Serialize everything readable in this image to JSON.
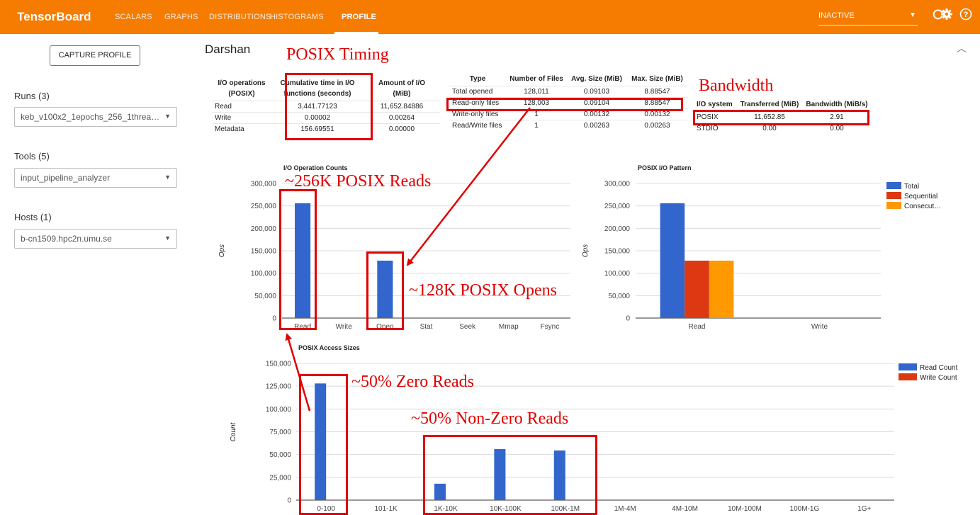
{
  "app": {
    "brand": "TensorBoard",
    "tabs": [
      "SCALARS",
      "GRAPHS",
      "DISTRIBUTIONS",
      "HISTOGRAMS",
      "PROFILE"
    ],
    "active_tab": "PROFILE",
    "run_selector": "INACTIVE",
    "icons": [
      "refresh-icon",
      "settings-icon",
      "help-icon"
    ],
    "accent_color": "#f57c00"
  },
  "sidebar": {
    "capture_button": "CAPTURE PROFILE",
    "runs_label": "Runs (3)",
    "runs_value": "keb_v100x2_1epochs_256_1threa…",
    "tools_label": "Tools (5)",
    "tools_value": "input_pipeline_analyzer",
    "hosts_label": "Hosts (1)",
    "hosts_value": "b-cn1509.hpc2n.umu.se"
  },
  "main": {
    "title": "Darshan",
    "io_table": {
      "headers": [
        [
          "I/O operations",
          "(POSIX)"
        ],
        [
          "Cumulative time in I/O",
          "functions (seconds)"
        ],
        [
          "Amount of I/O",
          "(MiB)"
        ]
      ],
      "rows": [
        [
          "Read",
          "3,441.77123",
          "11,652.84886"
        ],
        [
          "Write",
          "0.00002",
          "0.00264"
        ],
        [
          "Metadata",
          "156.69551",
          "0.00000"
        ]
      ]
    },
    "files_table": {
      "headers": [
        "Type",
        "Number of Files",
        "Avg. Size (MiB)",
        "Max. Size (MiB)"
      ],
      "rows": [
        [
          "Total opened",
          "128,011",
          "0.09103",
          "8.88547"
        ],
        [
          "Read-only files",
          "128,003",
          "0.09104",
          "8.88547"
        ],
        [
          "Write-only files",
          "1",
          "0.00132",
          "0.00132"
        ],
        [
          "Read/Write files",
          "1",
          "0.00263",
          "0.00263"
        ]
      ]
    },
    "bw_table": {
      "headers": [
        "I/O system",
        "Transferred (MiB)",
        "Bandwidth (MiB/s)"
      ],
      "rows": [
        [
          "POSIX",
          "11,652.85",
          "2.91"
        ],
        [
          "STDIO",
          "0.00",
          "0.00"
        ]
      ]
    },
    "annotations": {
      "posix_timing": "POSIX Timing",
      "bandwidth": "Bandwidth",
      "posix_reads": "~256K POSIX Reads",
      "posix_opens": "~128K POSIX Opens",
      "zero_reads": "~50% Zero Reads",
      "nonzero_reads": "~50% Non-Zero Reads"
    }
  },
  "chart_data": [
    {
      "type": "bar",
      "title": "I/O Operation Counts",
      "ylabel": "Ops",
      "categories": [
        "Read",
        "Write",
        "Open",
        "Stat",
        "Seek",
        "Mmap",
        "Fsync"
      ],
      "values": [
        256000,
        0,
        128000,
        0,
        0,
        0,
        0
      ],
      "ylim": [
        0,
        300000
      ],
      "yticks": [
        "0",
        "50,000",
        "100,000",
        "150,000",
        "200,000",
        "250,000",
        "300,000"
      ],
      "colors": [
        "#3366cc"
      ]
    },
    {
      "type": "bar",
      "title": "POSIX I/O Pattern",
      "ylabel": "Ops",
      "categories": [
        "Read",
        "Write"
      ],
      "series": [
        {
          "name": "Total",
          "values": [
            256000,
            0
          ]
        },
        {
          "name": "Sequential",
          "values": [
            128000,
            0
          ]
        },
        {
          "name": "Consecut…",
          "values": [
            128000,
            0
          ]
        }
      ],
      "ylim": [
        0,
        300000
      ],
      "yticks": [
        "0",
        "50,000",
        "100,000",
        "150,000",
        "200,000",
        "250,000",
        "300,000"
      ],
      "colors": [
        "#3366cc",
        "#dc3912",
        "#ff9900"
      ],
      "legend": "right"
    },
    {
      "type": "bar",
      "title": "POSIX Access Sizes",
      "ylabel": "Count",
      "categories": [
        "0-100",
        "101-1K",
        "1K-10K",
        "10K-100K",
        "100K-1M",
        "1M-4M",
        "4M-10M",
        "10M-100M",
        "100M-1G",
        "1G+"
      ],
      "series": [
        {
          "name": "Read Count",
          "values": [
            128000,
            0,
            18000,
            56000,
            54500,
            0,
            0,
            0,
            0,
            0
          ]
        },
        {
          "name": "Write Count",
          "values": [
            0,
            0,
            0,
            0,
            0,
            0,
            0,
            0,
            0,
            0
          ]
        }
      ],
      "ylim": [
        0,
        150000
      ],
      "yticks": [
        "0",
        "25,000",
        "50,000",
        "75,000",
        "100,000",
        "125,000",
        "150,000"
      ],
      "colors": [
        "#3366cc",
        "#dc3912"
      ],
      "legend": "right"
    }
  ]
}
